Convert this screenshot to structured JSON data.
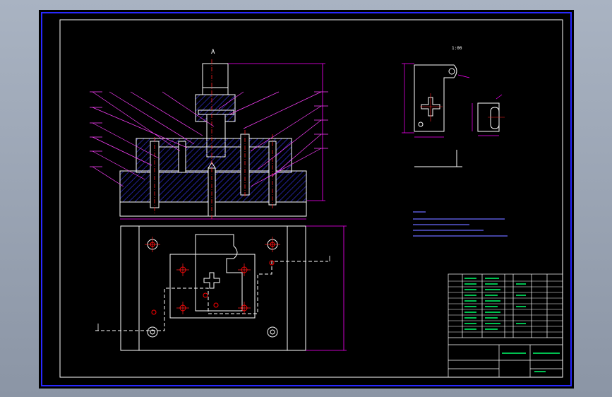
{
  "drawing": {
    "view_label": "A",
    "part_view_label": "1:00"
  },
  "colors": {
    "background": "#000000",
    "viewport_bg": "#000000",
    "outline": "#ffffff",
    "border_blue": "#2828ff",
    "dimension": "#ff00ff",
    "hatch": "#3a3aff",
    "center_line": "#ff2020",
    "leader": "#ff40ff",
    "table_text": "#00ff60",
    "part_outline": "#ffffff",
    "hole_mark": "#ff0000"
  },
  "icons": {
    "screw": "cap-screw-icon",
    "pin": "dowel-pin-icon",
    "punch": "punch-icon"
  }
}
